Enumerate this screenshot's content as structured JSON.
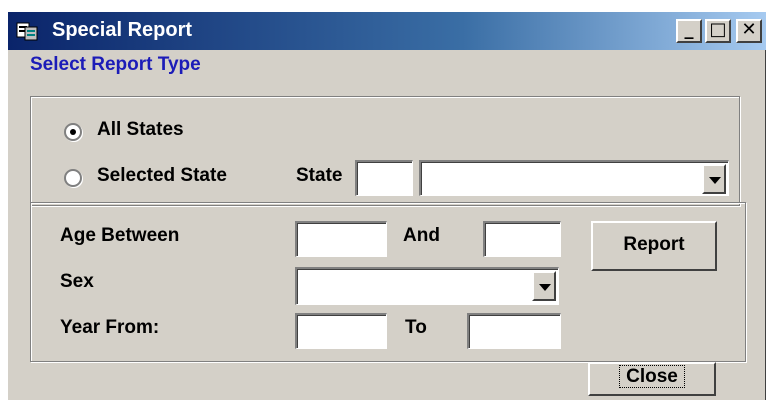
{
  "window": {
    "title": "Special Report",
    "minimize": "_",
    "maximize": "□",
    "close": "✕"
  },
  "section_label": "Select Report Type",
  "report_type": {
    "options": [
      {
        "label": "All States",
        "selected": true
      },
      {
        "label": "Selected State",
        "selected": false
      }
    ],
    "state_label": "State",
    "state_code_value": "",
    "state_dropdown_value": ""
  },
  "filters": {
    "age_between_label": "Age Between",
    "age_from_value": "",
    "and_label": "And",
    "age_to_value": "",
    "sex_label": "Sex",
    "sex_value": "",
    "year_from_label": "Year From:",
    "year_from_value": "",
    "to_label": "To",
    "year_to_value": "",
    "report_button": "Report"
  },
  "close_button": "Close",
  "icons": [
    "app-icon",
    "minimize-icon",
    "maximize-icon",
    "close-icon",
    "dropdown-arrow-icon"
  ],
  "colors": {
    "title_gradient_start": "#0a246a",
    "title_gradient_end": "#a6caf0",
    "section_label": "#1c1cb8",
    "window_face": "#d4d0c8"
  }
}
